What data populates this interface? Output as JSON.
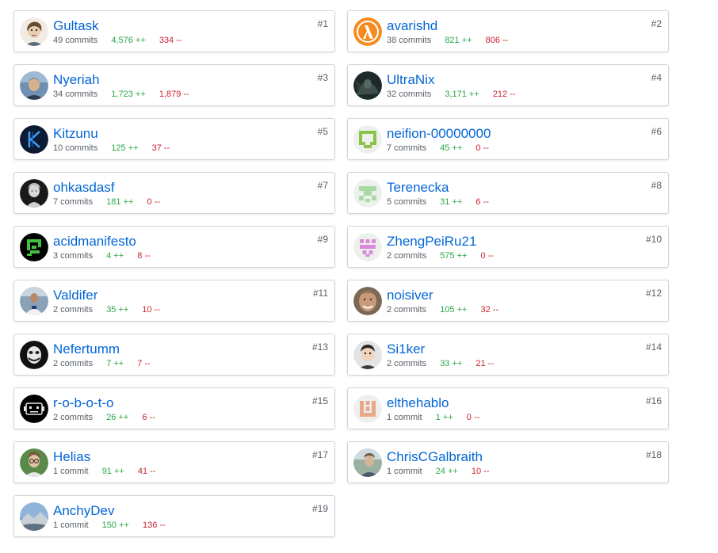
{
  "contributors": [
    {
      "rank": "#1",
      "name": "Gultask",
      "commits": "49 commits",
      "additions": "4,576 ++",
      "deletions": "334 --",
      "avatar": "sketch-face-avatar"
    },
    {
      "rank": "#2",
      "name": "avarishd",
      "commits": "38 commits",
      "additions": "821 ++",
      "deletions": "806 --",
      "avatar": "lambda-avatar"
    },
    {
      "rank": "#3",
      "name": "Nyeriah",
      "commits": "34 commits",
      "additions": "1,723 ++",
      "deletions": "1,879 --",
      "avatar": "photo-avatar"
    },
    {
      "rank": "#4",
      "name": "UltraNix",
      "commits": "32 commits",
      "additions": "3,171 ++",
      "deletions": "212 --",
      "avatar": "dark-photo-avatar"
    },
    {
      "rank": "#5",
      "name": "Kitzunu",
      "commits": "10 commits",
      "additions": "125 ++",
      "deletions": "37 --",
      "avatar": "k-logo-avatar"
    },
    {
      "rank": "#6",
      "name": "neifion-00000000",
      "commits": "7 commits",
      "additions": "45 ++",
      "deletions": "0 --",
      "avatar": "identicon-green-avatar"
    },
    {
      "rank": "#7",
      "name": "ohkasdasf",
      "commits": "7 commits",
      "additions": "181 ++",
      "deletions": "0 --",
      "avatar": "statue-avatar"
    },
    {
      "rank": "#8",
      "name": "Terenecka",
      "commits": "5 commits",
      "additions": "31 ++",
      "deletions": "6 --",
      "avatar": "identicon-lightgreen-avatar"
    },
    {
      "rank": "#9",
      "name": "acidmanifesto",
      "commits": "3 commits",
      "additions": "4 ++",
      "deletions": "8 --",
      "avatar": "pixel-green-avatar"
    },
    {
      "rank": "#10",
      "name": "ZhengPeiRu21",
      "commits": "2 commits",
      "additions": "575 ++",
      "deletions": "0 --",
      "avatar": "identicon-pink-avatar"
    },
    {
      "rank": "#11",
      "name": "Valdifer",
      "commits": "2 commits",
      "additions": "35 ++",
      "deletions": "10 --",
      "avatar": "player-photo-avatar"
    },
    {
      "rank": "#12",
      "name": "noisiver",
      "commits": "2 commits",
      "additions": "105 ++",
      "deletions": "32 --",
      "avatar": "face-photo-avatar"
    },
    {
      "rank": "#13",
      "name": "Nefertumm",
      "commits": "2 commits",
      "additions": "7 ++",
      "deletions": "7 --",
      "avatar": "joker-avatar"
    },
    {
      "rank": "#14",
      "name": "Si1ker",
      "commits": "2 commits",
      "additions": "33 ++",
      "deletions": "21 --",
      "avatar": "cartoon-face-avatar"
    },
    {
      "rank": "#15",
      "name": "r-o-b-o-t-o",
      "commits": "2 commits",
      "additions": "26 ++",
      "deletions": "6 --",
      "avatar": "robot-avatar"
    },
    {
      "rank": "#16",
      "name": "elthehablo",
      "commits": "1 commit",
      "additions": "1 ++",
      "deletions": "0 --",
      "avatar": "identicon-peach-avatar"
    },
    {
      "rank": "#17",
      "name": "Helias",
      "commits": "1 commit",
      "additions": "91 ++",
      "deletions": "41 --",
      "avatar": "glasses-photo-avatar"
    },
    {
      "rank": "#18",
      "name": "ChrisCGalbraith",
      "commits": "1 commit",
      "additions": "24 ++",
      "deletions": "10 --",
      "avatar": "outdoor-photo-avatar"
    },
    {
      "rank": "#19",
      "name": "AnchyDev",
      "commits": "1 commit",
      "additions": "150 ++",
      "deletions": "136 --",
      "avatar": "landscape-avatar"
    }
  ],
  "colors": {
    "link": "#0366d6",
    "additions": "#28a745",
    "deletions": "#cb2431",
    "muted": "#586069",
    "border": "#d1d5da"
  }
}
